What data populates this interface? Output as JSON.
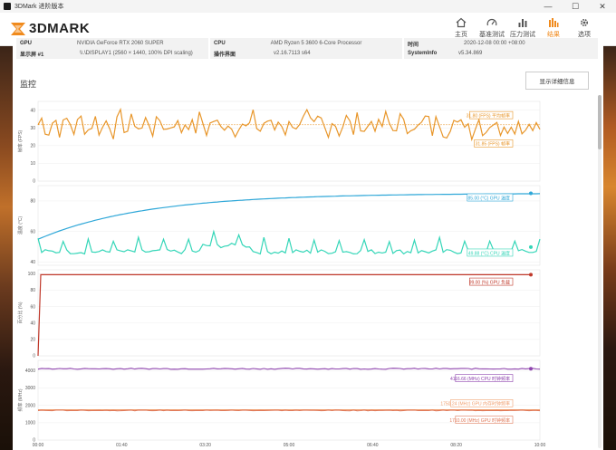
{
  "window": {
    "title": "3DMark 进阶版本",
    "min": "—",
    "max": "☐",
    "close": "✕"
  },
  "header": {
    "logo_text": "3DMARK"
  },
  "nav": [
    {
      "label": "主页",
      "icon": "home-icon"
    },
    {
      "label": "基准测试",
      "icon": "gauge-icon"
    },
    {
      "label": "压力测试",
      "icon": "bars-icon"
    },
    {
      "label": "结果",
      "icon": "results-icon",
      "active": true
    },
    {
      "label": "选项",
      "icon": "gear-icon"
    }
  ],
  "info": {
    "row1": [
      {
        "key": "GPU",
        "value": "NVIDIA GeForce RTX 2060 SUPER"
      },
      {
        "key": "CPU",
        "value": "AMD Ryzen 5 3600 6-Core Processor"
      },
      {
        "key": "时间",
        "value": "2020-12-08 00:00 +08:00"
      }
    ],
    "row2": [
      {
        "key": "显示屏 #1",
        "value": "\\\\.\\DISPLAY1 (2560 × 1440, 100% DPI scaling)"
      },
      {
        "key": "操作界面",
        "value": "v2.16.7113 s64"
      },
      {
        "key": "SystemInfo",
        "value": "v5.34.869"
      }
    ]
  },
  "monitor": {
    "title": "监控",
    "detail_button": "显示详细信息"
  },
  "colors": {
    "fps": "#e8962a",
    "gpu_temp": "#2ea7d8",
    "cpu_temp": "#35d6b8",
    "gpu_load": "#c0392b",
    "cpu_clock": "#8e44ad",
    "gpu_mem_clock": "#f0a070",
    "gpu_clock": "#e07a5a"
  },
  "chart_data": [
    {
      "type": "line",
      "ylabel": "帧率 (FPS)",
      "yticks": [
        0,
        10,
        20,
        30,
        40
      ],
      "ylim": [
        0,
        45
      ],
      "series": [
        {
          "name": "帧率",
          "label": "31.80 (FPS) 平均帧率",
          "value": 31.8
        },
        {
          "name": "帧率",
          "label": "31.85 (FPS) 帧率",
          "value": 31.85
        }
      ]
    },
    {
      "type": "line",
      "ylabel": "温度 (°C)",
      "yticks": [
        40,
        60,
        80
      ],
      "ylim": [
        38,
        90
      ],
      "series": [
        {
          "name": "GPU 温度",
          "label": "85.00 (°C) GPU 温度",
          "value": 85.0
        },
        {
          "name": "CPU 温度",
          "label": "49.88 (°C) CPU 温度",
          "value": 49.88
        }
      ]
    },
    {
      "type": "line",
      "ylabel": "百分比 (%)",
      "yticks": [
        0,
        20,
        40,
        60,
        80,
        100
      ],
      "ylim": [
        0,
        105
      ],
      "series": [
        {
          "name": "GPU 负载",
          "label": "99.00 (%) GPU 负载",
          "value": 99.0
        }
      ]
    },
    {
      "type": "line",
      "ylabel": "频率 (MHz)",
      "yticks": [
        0,
        1000,
        2000,
        3000,
        4000
      ],
      "ylim": [
        0,
        4600
      ],
      "series": [
        {
          "name": "CPU 时钟频率",
          "label": "4116.66 (MHz) CPU 时钟频率",
          "value": 4116.66
        },
        {
          "name": "GPU 内存时钟频率",
          "label": "1750.24 (MHz) GPU 内存时钟频率",
          "value": 1750.24
        },
        {
          "name": "GPU 时钟频率",
          "label": "1710.00 (MHz) GPU 时钟频率",
          "value": 1710.0
        }
      ]
    }
  ],
  "xaxis": {
    "ticks": [
      "00:00",
      "01:40",
      "03:20",
      "05:00",
      "06:40",
      "08:20",
      "10:00"
    ]
  }
}
